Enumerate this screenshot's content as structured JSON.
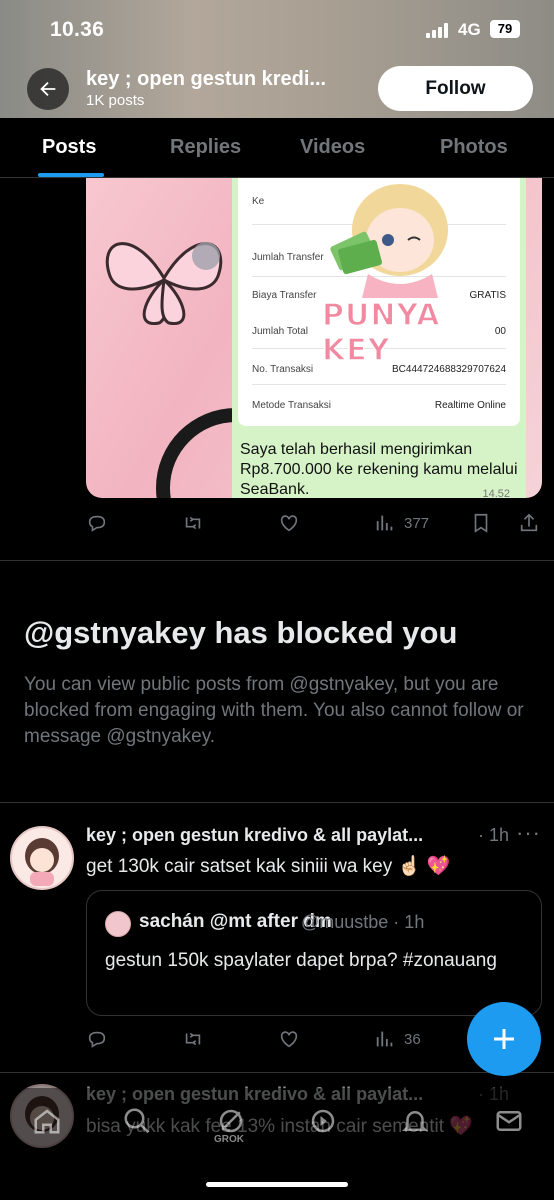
{
  "status_bar": {
    "time": "10.36",
    "network": "4G",
    "battery": "79"
  },
  "header": {
    "back_icon": "arrow-left-icon",
    "profile_name": "key ; open gestun kredi...",
    "post_count": "1K posts",
    "follow_label": "Follow"
  },
  "tabs": [
    {
      "label": "Posts",
      "active": true
    },
    {
      "label": "Replies",
      "active": false
    },
    {
      "label": "Videos",
      "active": false
    },
    {
      "label": "Photos",
      "active": false
    }
  ],
  "pinned_media": {
    "receipt": {
      "rows": [
        {
          "label": "Ke",
          "value": ""
        },
        {
          "label": "Jumlah Transfer",
          "value": ""
        },
        {
          "label": "Biaya Transfer",
          "value": "GRATIS"
        },
        {
          "label": "Jumlah Total",
          "value": "00"
        },
        {
          "label": "No. Transaksi",
          "value": "BC444724688329707624"
        },
        {
          "label": "Metode Transaksi",
          "value": "Realtime Online"
        }
      ],
      "watermark": "PUNYA KEY",
      "message": "Saya telah berhasil mengirimkan Rp8.700.000 ke rekening kamu melalui SeaBank.",
      "time": "14.52"
    }
  },
  "post1_actions": {
    "views": "377"
  },
  "blocked_notice": {
    "title": "@gstnyakey has blocked you",
    "description": "You can view public posts from @gstnyakey, but you are blocked from engaging with them. You also cannot follow or message @gstnyakey."
  },
  "posts": [
    {
      "name": "key ; open gestun kredivo & all paylat...",
      "time": "1h",
      "text": "get 130k cair satset kak siniii wa key ☝🏻 💖",
      "quote": {
        "name": "sachán @mt after dm",
        "handle": "@muustbe · 1h",
        "text": "gestun 150k spaylater dapet brpa? #zonauang"
      },
      "views": "36"
    },
    {
      "name": "key ; open gestun kredivo & all paylat...",
      "time": "1h",
      "text": "bisa yukk kak fee 13% instan cair sementit 💖"
    }
  ],
  "fab": {
    "icon": "plus-icon"
  },
  "bottom_nav": {
    "items": [
      "home-icon",
      "search-icon",
      "grok-icon",
      "communities-icon",
      "notifications-icon",
      "messages-icon"
    ],
    "grok_label": "GROK"
  },
  "colors": {
    "accent": "#1d9bf0",
    "background": "#000000",
    "text_primary": "#e7e9ea",
    "text_secondary": "#71767b"
  }
}
